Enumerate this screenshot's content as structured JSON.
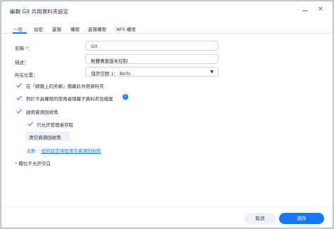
{
  "window": {
    "title": "編輯 Git 共用資料夾設定"
  },
  "tabs": [
    {
      "label": "一般",
      "active": true
    },
    {
      "label": "加密",
      "active": false
    },
    {
      "label": "進階",
      "active": false
    },
    {
      "label": "權限",
      "active": false
    },
    {
      "label": "進階權限",
      "active": false
    },
    {
      "label": "NFS 權限",
      "active": false
    }
  ],
  "form": {
    "name_label": "名稱",
    "name_required_mark": "*",
    "name_colon": "：",
    "name_value": "Git",
    "desc_label": "描述：",
    "desc_value": "軟體專案版本控制",
    "location_label": "所在位置：",
    "location_value": "儲存空間 1： Btrfs"
  },
  "checkboxes": {
    "hide_network": {
      "label": "在「網路上的芳鄰」隱藏此共用資料夾",
      "checked": true
    },
    "hide_no_perm": {
      "label": "對於不具權限的使用者隱藏子資料夾及檔案",
      "checked": true
    },
    "recycle_bin": {
      "label": "啟用資源回收筒",
      "checked": true
    },
    "admin_only": {
      "label": "只允許管理者存取",
      "checked": true
    }
  },
  "actions": {
    "empty_recycle_label": "清空資源回收筒"
  },
  "note": {
    "prefix": "注意：",
    "link": "如何設定排程清空資源回收筒"
  },
  "footnote": {
    "mark": "*",
    "text": "欄位不允許空白"
  },
  "footer": {
    "cancel_label": "取消",
    "save_label": "儲存"
  },
  "colors": {
    "accent": "#1677ff",
    "required": "#e0424a"
  }
}
